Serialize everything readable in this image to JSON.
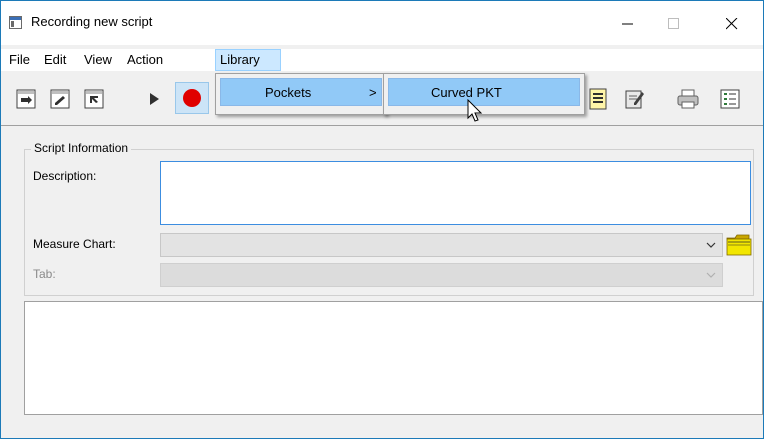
{
  "window": {
    "title": "Recording new script",
    "icon": "app-window-icon",
    "controls": [
      "minimize-icon",
      "maximize-icon",
      "close-icon"
    ]
  },
  "menubar": {
    "items": [
      {
        "label": "File"
      },
      {
        "label": "Edit"
      },
      {
        "label": "View"
      },
      {
        "label": "Action"
      },
      {
        "label": "Library",
        "active": true
      }
    ]
  },
  "toolbar": {
    "icons": [
      "script-import-icon",
      "script-edit-icon",
      "script-export-icon",
      "play-icon",
      "record-icon",
      "list-icon",
      "notes-icon",
      "print-icon",
      "details-icon"
    ],
    "record_color": "#e00000"
  },
  "library_menu": {
    "items": [
      {
        "label": "Pockets",
        "submenu_arrow": ">"
      }
    ]
  },
  "pockets_submenu": {
    "items": [
      {
        "label": "Curved PKT",
        "highlighted": true
      }
    ]
  },
  "script_info": {
    "group_title": "Script Information",
    "description_label": "Description:",
    "description_value": "",
    "measure_chart_label": "Measure Chart:",
    "measure_chart_value": "",
    "tab_label": "Tab:",
    "tab_value": ""
  },
  "colors": {
    "accent_border": "#3c8de0",
    "menu_highlight": "#91c9f7",
    "window_border": "#1c7ab8"
  }
}
